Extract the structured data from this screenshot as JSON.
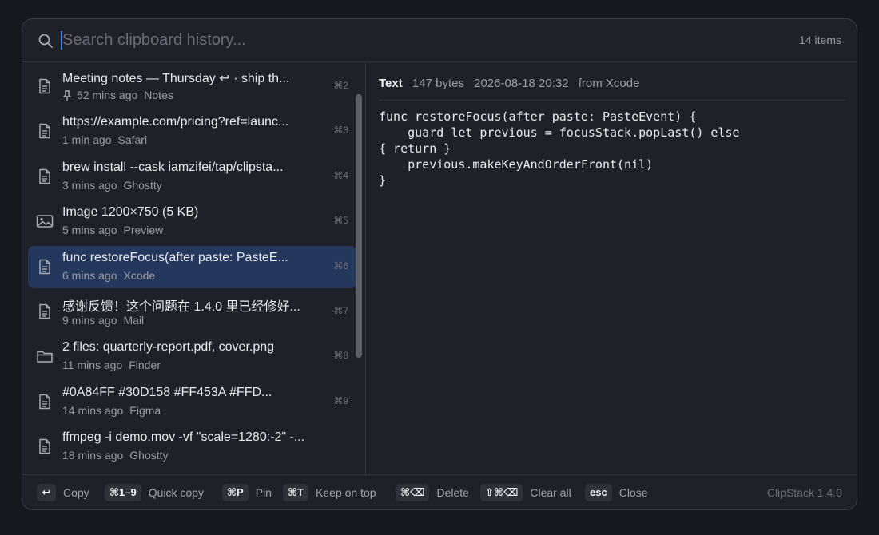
{
  "search": {
    "placeholder": "Search clipboard history...",
    "value": "",
    "count": "14 items"
  },
  "items": [
    {
      "icon": "text-document-icon",
      "title": "Meeting notes — Thursday ↩ · ship th...",
      "pinned": true,
      "time": "52 mins ago",
      "app": "Notes",
      "shortcut": "⌘2"
    },
    {
      "icon": "text-document-icon",
      "title": "https://example.com/pricing?ref=launc...",
      "pinned": false,
      "time": "1 min ago",
      "app": "Safari",
      "shortcut": "⌘3"
    },
    {
      "icon": "text-document-icon",
      "title": "brew install --cask iamzifei/tap/clipsta...",
      "pinned": false,
      "time": "3 mins ago",
      "app": "Ghostty",
      "shortcut": "⌘4"
    },
    {
      "icon": "image-icon",
      "title": "Image 1200×750 (5 KB)",
      "pinned": false,
      "time": "5 mins ago",
      "app": "Preview",
      "shortcut": "⌘5"
    },
    {
      "icon": "text-document-icon",
      "title": "func restoreFocus(after paste: PasteE...",
      "pinned": false,
      "time": "6 mins ago",
      "app": "Xcode",
      "shortcut": "⌘6",
      "selected": true
    },
    {
      "icon": "text-document-icon",
      "title": "感谢反馈！这个问题在 1.4.0 里已经修好...",
      "pinned": false,
      "time": "9 mins ago",
      "app": "Mail",
      "shortcut": "⌘7"
    },
    {
      "icon": "folder-icon",
      "title": "2 files: quarterly-report.pdf, cover.png",
      "pinned": false,
      "time": "11 mins ago",
      "app": "Finder",
      "shortcut": "⌘8"
    },
    {
      "icon": "text-document-icon",
      "title": "#0A84FF   #30D158   #FF453A   #FFD...",
      "pinned": false,
      "time": "14 mins ago",
      "app": "Figma",
      "shortcut": "⌘9"
    },
    {
      "icon": "text-document-icon",
      "title": "ffmpeg -i demo.mov -vf \"scale=1280:-2\" -...",
      "pinned": false,
      "time": "18 mins ago",
      "app": "Ghostty",
      "shortcut": ""
    }
  ],
  "detail": {
    "type": "Text",
    "size": "147 bytes",
    "date": "2026-08-18 20:32",
    "source": "from Xcode",
    "content": "func restoreFocus(after paste: PasteEvent) {\n    guard let previous = focusStack.popLast() else\n{ return }\n    previous.makeKeyAndOrderFront(nil)\n}"
  },
  "footer": {
    "hints": [
      {
        "key": "↩",
        "label": "Copy"
      },
      {
        "key": "⌘1–9",
        "label": "Quick copy"
      },
      {
        "key": "⌘P",
        "label": "Pin"
      },
      {
        "key": "⌘T",
        "label": "Keep on top"
      },
      {
        "key": "⌘⌫",
        "label": "Delete"
      },
      {
        "key": "⇧⌘⌫",
        "label": "Clear all"
      },
      {
        "key": "esc",
        "label": "Close"
      }
    ],
    "version": "ClipStack 1.4.0"
  },
  "colors": {
    "accent": "#3a8bff",
    "selected_row": "#24375c",
    "background": "#1f2028"
  }
}
